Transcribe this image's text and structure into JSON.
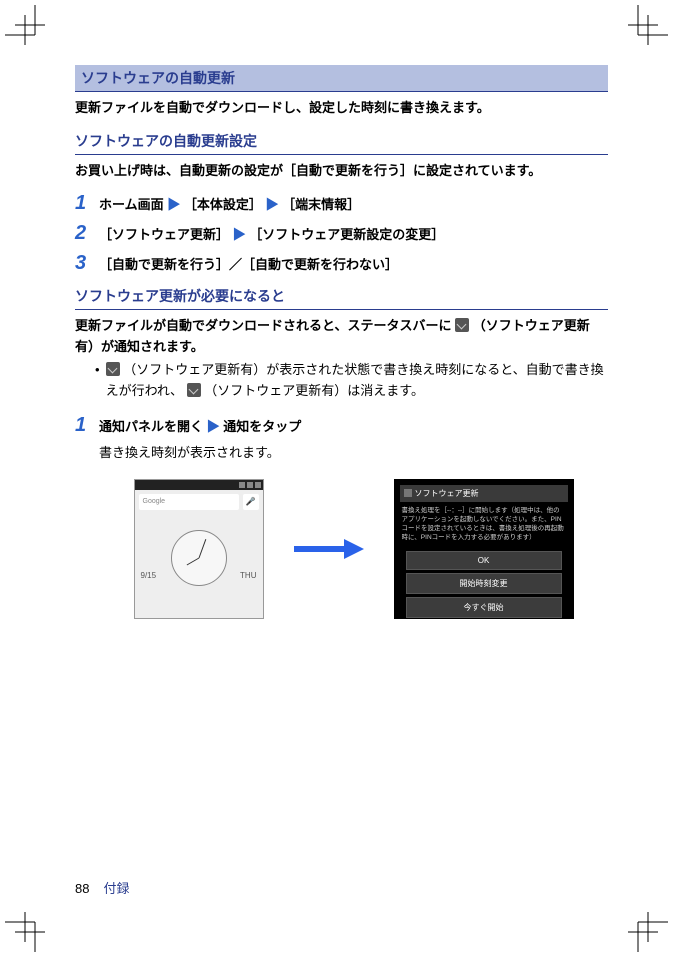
{
  "section_header": "ソフトウェアの自動更新",
  "intro": "更新ファイルを自動でダウンロードし、設定した時刻に書き換えます。",
  "sub_header_1": "ソフトウェアの自動更新設定",
  "note_1": "お買い上げ時は、自動更新の設定が［自動で更新を行う］に設定されています。",
  "steps_a": {
    "s1": {
      "num": "1",
      "pre": "ホーム画面",
      "a1": "［本体設定］",
      "a2": "［端末情報］"
    },
    "s2": {
      "num": "2",
      "pre": "［ソフトウェア更新］",
      "a1": "［ソフトウェア更新設定の変更］"
    },
    "s3": {
      "num": "3",
      "text": "［自動で更新を行う］／［自動で更新を行わない］"
    }
  },
  "sub_header_2": "ソフトウェア更新が必要になると",
  "para_2a": "更新ファイルが自動でダウンロードされると、ステータスバーに",
  "para_2b": "（ソフトウェア更新有）が通知されます。",
  "bullet_a": "（ソフトウェア更新有）が表示された状態で書き換え時刻になると、自動で書き換えが行われ、",
  "bullet_b": "（ソフトウェア更新有）は消えます。",
  "steps_b": {
    "s1": {
      "num": "1",
      "pre": "通知パネルを開く",
      "a1": "通知をタップ",
      "sub": "書き換え時刻が表示されます。"
    }
  },
  "phone": {
    "google": "Google",
    "date": "9/15",
    "day": "THU"
  },
  "dialog": {
    "title": "ソフトウェア更新",
    "msg": "書換え処理を［--：--］に開始します（処理中は、他のアプリケーションを起動しないでください。また、PINコードを設定されているときは、書換え処理後の再起動時に、PINコードを入力する必要があります）",
    "btn_ok": "OK",
    "btn_change": "開始時刻変更",
    "btn_now": "今すぐ開始"
  },
  "footer": {
    "page": "88",
    "section": "付録"
  },
  "arrow_glyph": "▶"
}
